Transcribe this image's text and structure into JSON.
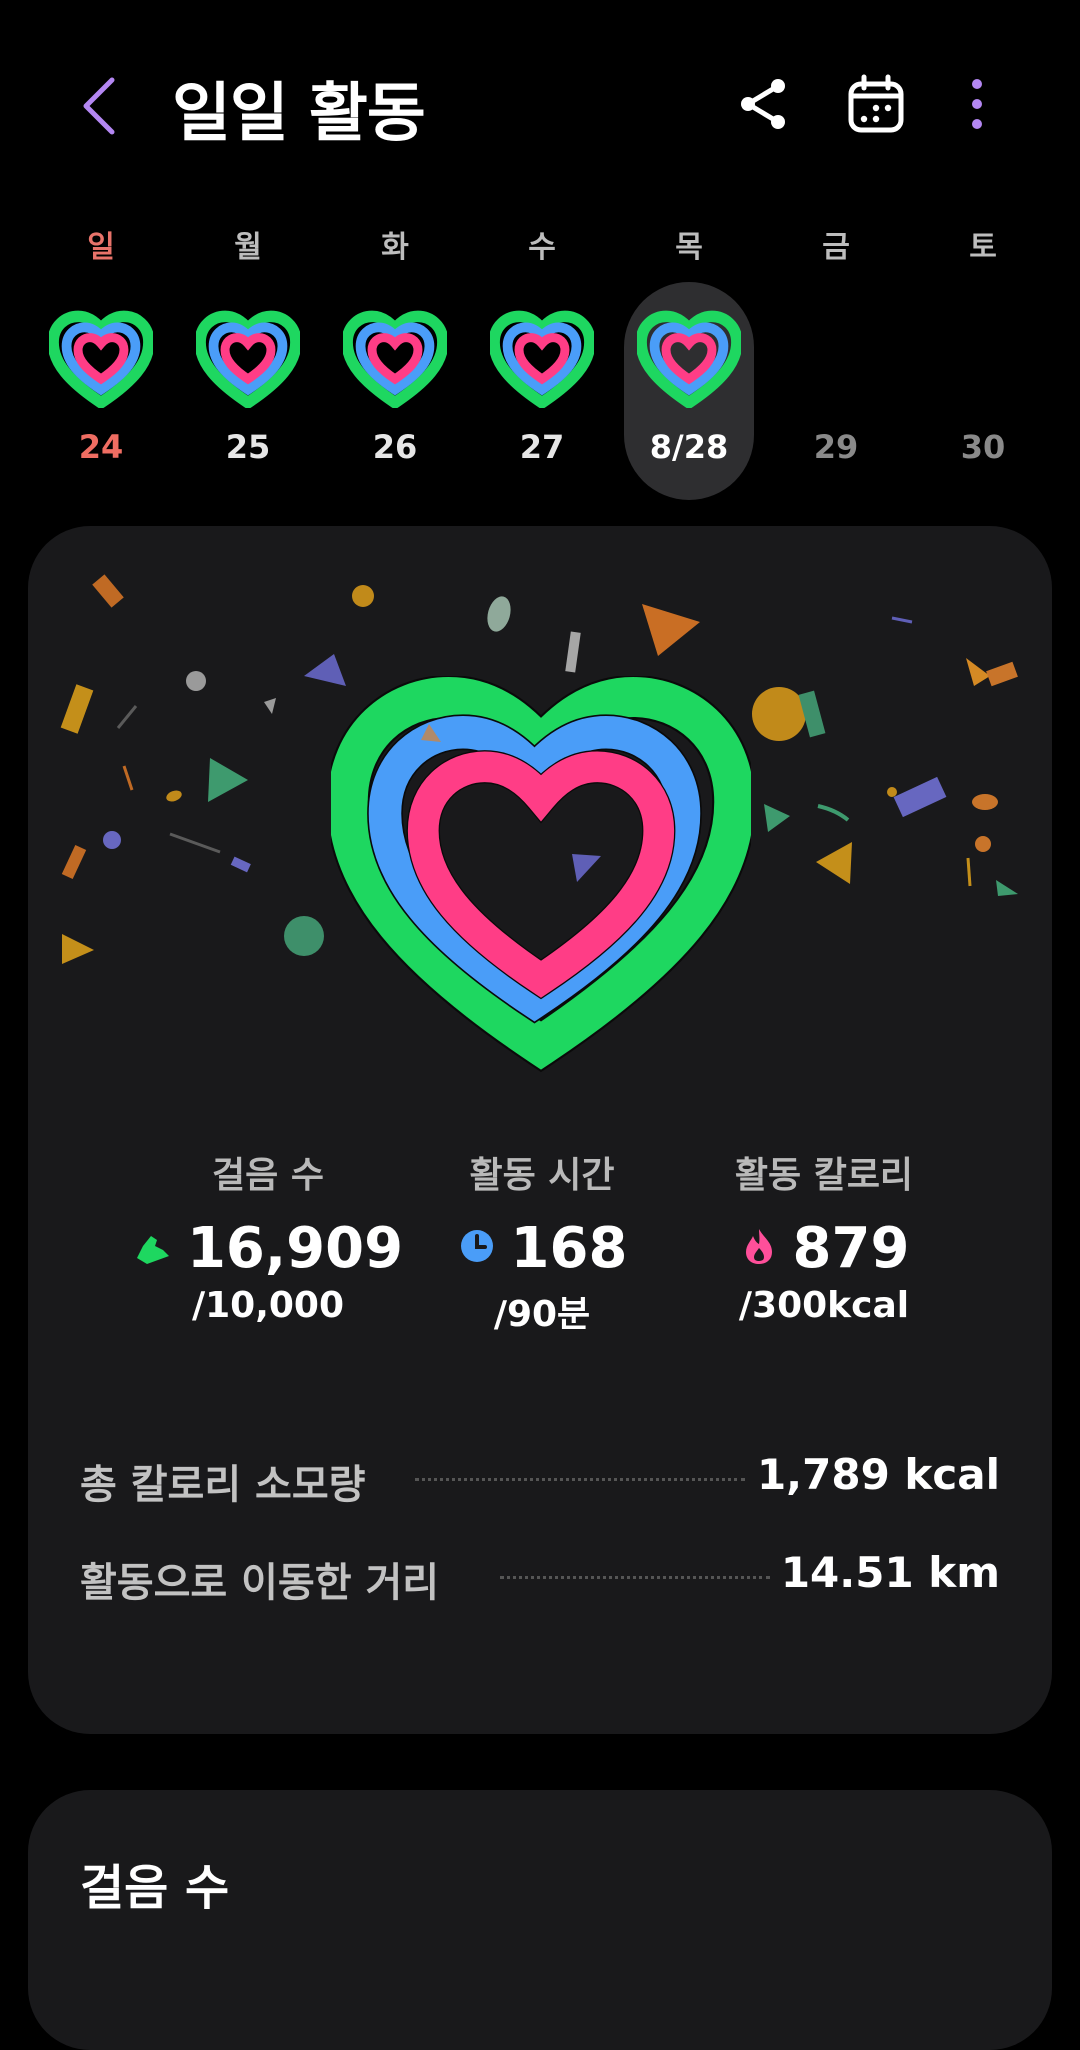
{
  "header": {
    "title": "일일 활동",
    "back_icon": "chevron-left-icon",
    "share_icon": "share-icon",
    "calendar_icon": "calendar-icon",
    "more_icon": "more-vertical-icon"
  },
  "week": {
    "days": [
      {
        "dow": "일",
        "date": "24",
        "has_heart": true
      },
      {
        "dow": "월",
        "date": "25",
        "has_heart": true
      },
      {
        "dow": "화",
        "date": "26",
        "has_heart": true
      },
      {
        "dow": "수",
        "date": "27",
        "has_heart": true
      },
      {
        "dow": "목",
        "date": "8/28",
        "has_heart": true,
        "selected": true
      },
      {
        "dow": "금",
        "date": "29",
        "has_heart": false
      },
      {
        "dow": "토",
        "date": "30",
        "has_heart": false
      }
    ]
  },
  "summary": {
    "steps": {
      "label": "걸음 수",
      "value": "16,909",
      "goal": "/10,000",
      "icon": "shoe-icon",
      "color": "#1ed760"
    },
    "active_time": {
      "label": "활동 시간",
      "value": "168",
      "goal": "/90분",
      "icon": "clock-icon",
      "color": "#4a9df8"
    },
    "active_calories": {
      "label": "활동 칼로리",
      "value": "879",
      "goal": "/300kcal",
      "icon": "flame-icon",
      "color": "#ff4f9a"
    },
    "total_calories": {
      "label": "총 칼로리 소모량",
      "value": "1,789  kcal"
    },
    "distance": {
      "label": "활동으로 이동한 거리",
      "value": "14.51  km"
    }
  },
  "steps_card": {
    "title": "걸음 수"
  },
  "colors": {
    "background": "#000000",
    "card": "#19191b",
    "ring_green": "#1ed760",
    "ring_blue": "#4a9df8",
    "ring_pink": "#ff3d86",
    "accent_purple": "#b487f2",
    "sunday_red": "#ef6d62"
  }
}
